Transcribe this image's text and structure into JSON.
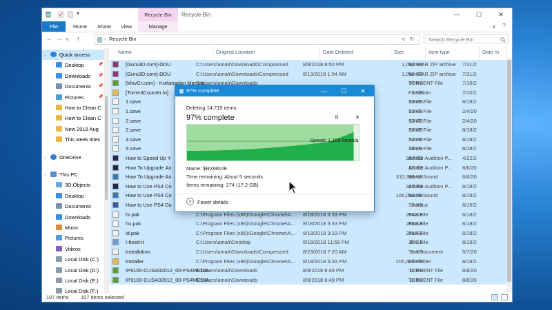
{
  "window": {
    "title": "Recycle Bin",
    "context_tab": "Recycle Bin Tools",
    "controls": [
      "—",
      "☐",
      "✕"
    ]
  },
  "ribbon": {
    "tabs": [
      "File",
      "Home",
      "Share",
      "View",
      "Manage"
    ]
  },
  "address": {
    "path": "Recycle Bin",
    "search_placeholder": "Search Recycle Bin",
    "nav": {
      "back": "←",
      "forward": "→",
      "dropdown": "∨",
      "up": "↑",
      "expand": "›",
      "path_dropdown": "∨",
      "refresh": "↻"
    }
  },
  "sidebar": {
    "items": [
      {
        "label": "Quick access",
        "indent": 0,
        "icon": "star",
        "selected": true,
        "pinned": false
      },
      {
        "label": "Desktop",
        "indent": 1,
        "icon": "folder-blue",
        "pinned": true
      },
      {
        "label": "Downloads",
        "indent": 1,
        "icon": "download",
        "pinned": true
      },
      {
        "label": "Documents",
        "indent": 1,
        "icon": "doc",
        "pinned": true
      },
      {
        "label": "Pictures",
        "indent": 1,
        "icon": "pic",
        "pinned": true
      },
      {
        "label": "How to Clean C",
        "indent": 1,
        "icon": "folder",
        "pinned": false
      },
      {
        "label": "How to Clean C",
        "indent": 1,
        "icon": "folder",
        "pinned": false
      },
      {
        "label": "New 2018 Aug",
        "indent": 1,
        "icon": "folder",
        "pinned": false
      },
      {
        "label": "This week titles",
        "indent": 1,
        "icon": "folder",
        "pinned": false
      },
      {
        "label": "OneDrive",
        "indent": 0,
        "icon": "cloud",
        "gap": true
      },
      {
        "label": "This PC",
        "indent": 0,
        "icon": "pc",
        "gap": true
      },
      {
        "label": "3D Objects",
        "indent": 1,
        "icon": "cube"
      },
      {
        "label": "Desktop",
        "indent": 1,
        "icon": "folder-blue"
      },
      {
        "label": "Documents",
        "indent": 1,
        "icon": "doc"
      },
      {
        "label": "Downloads",
        "indent": 1,
        "icon": "download"
      },
      {
        "label": "Music",
        "indent": 1,
        "icon": "music"
      },
      {
        "label": "Pictures",
        "indent": 1,
        "icon": "pic"
      },
      {
        "label": "Videos",
        "indent": 1,
        "icon": "video"
      },
      {
        "label": "Local Disk (C:)",
        "indent": 1,
        "icon": "disk"
      },
      {
        "label": "Local Disk (D:)",
        "indent": 1,
        "icon": "disk"
      },
      {
        "label": "Local Disk (E:)",
        "indent": 1,
        "icon": "disk"
      },
      {
        "label": "Local Disk (F:)",
        "indent": 1,
        "icon": "disk"
      }
    ],
    "pin_glyph": "📌"
  },
  "columns": [
    "Name",
    "Original Location",
    "Date Deleted",
    "Size",
    "Item type",
    "Date m"
  ],
  "files": [
    {
      "name": "[Guru3D.com]-DDU",
      "loc": "C:\\Users\\amalr\\Downloads\\Compressed",
      "date": "8/8/2018 8:50 PM",
      "size": "1,092 KB",
      "type": "WinRAR ZIP archive",
      "mod": "7/31/2",
      "icon": "zip"
    },
    {
      "name": "[Guru3D.com]-DDU",
      "loc": "C:\\Users\\amalr\\Downloads\\Compressed",
      "date": "8/13/2018 1:54 AM",
      "size": "1,092 KB",
      "type": "WinRAR ZIP archive",
      "mod": "7/31/2",
      "icon": "zip"
    },
    {
      "name": "[MovCr.com] - Kuttanadan Marpap...",
      "loc": "C:\\Users\\amalr\\Downloads",
      "date": "",
      "size": "57 KB",
      "type": "TORRENT File",
      "mod": "7/10/2",
      "icon": "torrent"
    },
    {
      "name": "[TorrentCounter.to]",
      "loc": "",
      "date": "",
      "size": "1 KB",
      "type": "File folder",
      "mod": "7/10/2",
      "icon": "folder"
    },
    {
      "name": "1.save",
      "loc": "",
      "date": "",
      "size": "52 KB",
      "type": "SAVE File",
      "mod": "8/18/2",
      "icon": "file"
    },
    {
      "name": "1.save",
      "loc": "",
      "date": "",
      "size": "52 KB",
      "type": "SAVE File",
      "mod": "2/4/20",
      "icon": "file"
    },
    {
      "name": "2.save",
      "loc": "",
      "date": "",
      "size": "52 KB",
      "type": "SAVE File",
      "mod": "2/4/20",
      "icon": "file"
    },
    {
      "name": "2.save",
      "loc": "",
      "date": "",
      "size": "52 KB",
      "type": "SAVE File",
      "mod": "8/18/2",
      "icon": "file"
    },
    {
      "name": "3.save",
      "loc": "",
      "date": "",
      "size": "52 KB",
      "type": "SAVE File",
      "mod": "8/18/2",
      "icon": "file"
    },
    {
      "name": "3.save",
      "loc": "",
      "date": "",
      "size": "38 KB",
      "type": "SAVE File",
      "mod": "8/18/2",
      "icon": "file"
    },
    {
      "name": "How to Speed Up Y",
      "loc": "",
      "date": "",
      "size": "396 KB",
      "type": "Adobe Audition P...",
      "mod": "4/22/2",
      "icon": "audition"
    },
    {
      "name": "How To Upgrade An",
      "loc": "",
      "date": "",
      "size": "50 KB",
      "type": "Adobe Audition P...",
      "mod": "8/6/20",
      "icon": "audition"
    },
    {
      "name": "How To Upgrade An",
      "loc": "",
      "date": "",
      "size": "310,389 KB",
      "type": "Wave Sound",
      "mod": "8/6/20",
      "icon": "wave"
    },
    {
      "name": "How to Use PS4 Co",
      "loc": "",
      "date": "",
      "size": "325 KB",
      "type": "Adobe Audition P...",
      "mod": "8/18/2",
      "icon": "audition"
    },
    {
      "name": "How to Use PS4 Co",
      "loc": "",
      "date": "",
      "size": "166,062 KB",
      "type": "Wave Sound",
      "mod": "8/18/2",
      "icon": "wave"
    },
    {
      "name": "How to Use PS4 Du",
      "loc": "",
      "date": "",
      "size": "3 KB",
      "type": "Shortcut",
      "mod": "8/15/2",
      "icon": "shortcut"
    },
    {
      "name": "hr.pak",
      "loc": "C:\\Program Files (x86)\\Google\\Chrome\\A...",
      "date": "8/18/2018 3:33 PM",
      "size": "254 KB",
      "type": "PAK File",
      "mod": "8/18/2",
      "icon": "file"
    },
    {
      "name": "hu.pak",
      "loc": "C:\\Program Files (x86)\\Google\\Chrome\\A...",
      "date": "8/18/2018 3:33 PM",
      "size": "258 KB",
      "type": "PAK File",
      "mod": "8/18/2",
      "icon": "file"
    },
    {
      "name": "id.pak",
      "loc": "C:\\Program Files (x86)\\Google\\Chrome\\A...",
      "date": "8/18/2018 3:33 PM",
      "size": "241 KB",
      "type": "PAK File",
      "mod": "8/18/2",
      "icon": "file"
    },
    {
      "name": "I-fixed-it",
      "loc": "C:\\Users\\amalr\\Desktop",
      "date": "8/19/2018 11:59 PM",
      "size": "20 KB",
      "type": "JPG File",
      "mod": "8/19/2",
      "icon": "image"
    },
    {
      "name": "Installation",
      "loc": "C:\\Users\\amalr\\Downloads\\Compressed",
      "date": "8/23/2018 7:20 AM",
      "size": "1 KB",
      "type": "Text Document",
      "mod": "5/7/20",
      "icon": "file"
    },
    {
      "name": "Installer",
      "loc": "C:\\Program Files (x86)\\Google\\Chrome\\A...",
      "date": "8/18/2018 3:33 PM",
      "size": "200,407 KB",
      "type": "File folder",
      "mod": "8/18/2",
      "icon": "folder"
    },
    {
      "name": "IP9100-CUSA02012_00-PS4MEDIA...",
      "loc": "C:\\Users\\amalr\\Downloads",
      "date": "8/8/2018 8:49 PM",
      "size": "11 KB",
      "type": "TORRENT File",
      "mod": "8/8/20",
      "icon": "torrent"
    },
    {
      "name": "IP9100-CUSA02012_00-PS4MEDIA...",
      "loc": "C:\\Users\\amalr\\Downloads",
      "date": "8/8/2018 8:49 PM",
      "size": "11 KB",
      "type": "TORRENT File",
      "mod": "8/8/20",
      "icon": "torrent"
    }
  ],
  "status": {
    "count": "107 items",
    "selected": "107 items selected"
  },
  "dialog": {
    "title": "97% complete",
    "deleting": "Deleting 14,715 items",
    "headline": "97% complete",
    "pause_glyph": "II",
    "close_glyph": "✕",
    "speed": "Speed: 1,106 items/s",
    "name": "Name: $RX68VIE",
    "time_remaining": "Time remaining: About 5 seconds",
    "items_remaining": "Items remaining: 274 (17.2 GB)",
    "fewer_details": "Fewer details",
    "fewer_glyph": "∧",
    "progress": 0.97,
    "controls": [
      "—",
      "☐",
      "✕"
    ]
  },
  "colors": {
    "accent": "#1979ca",
    "selection": "#cce8ff",
    "graph_fill": "#1fb04a",
    "graph_bg": "#9fdc9f"
  }
}
